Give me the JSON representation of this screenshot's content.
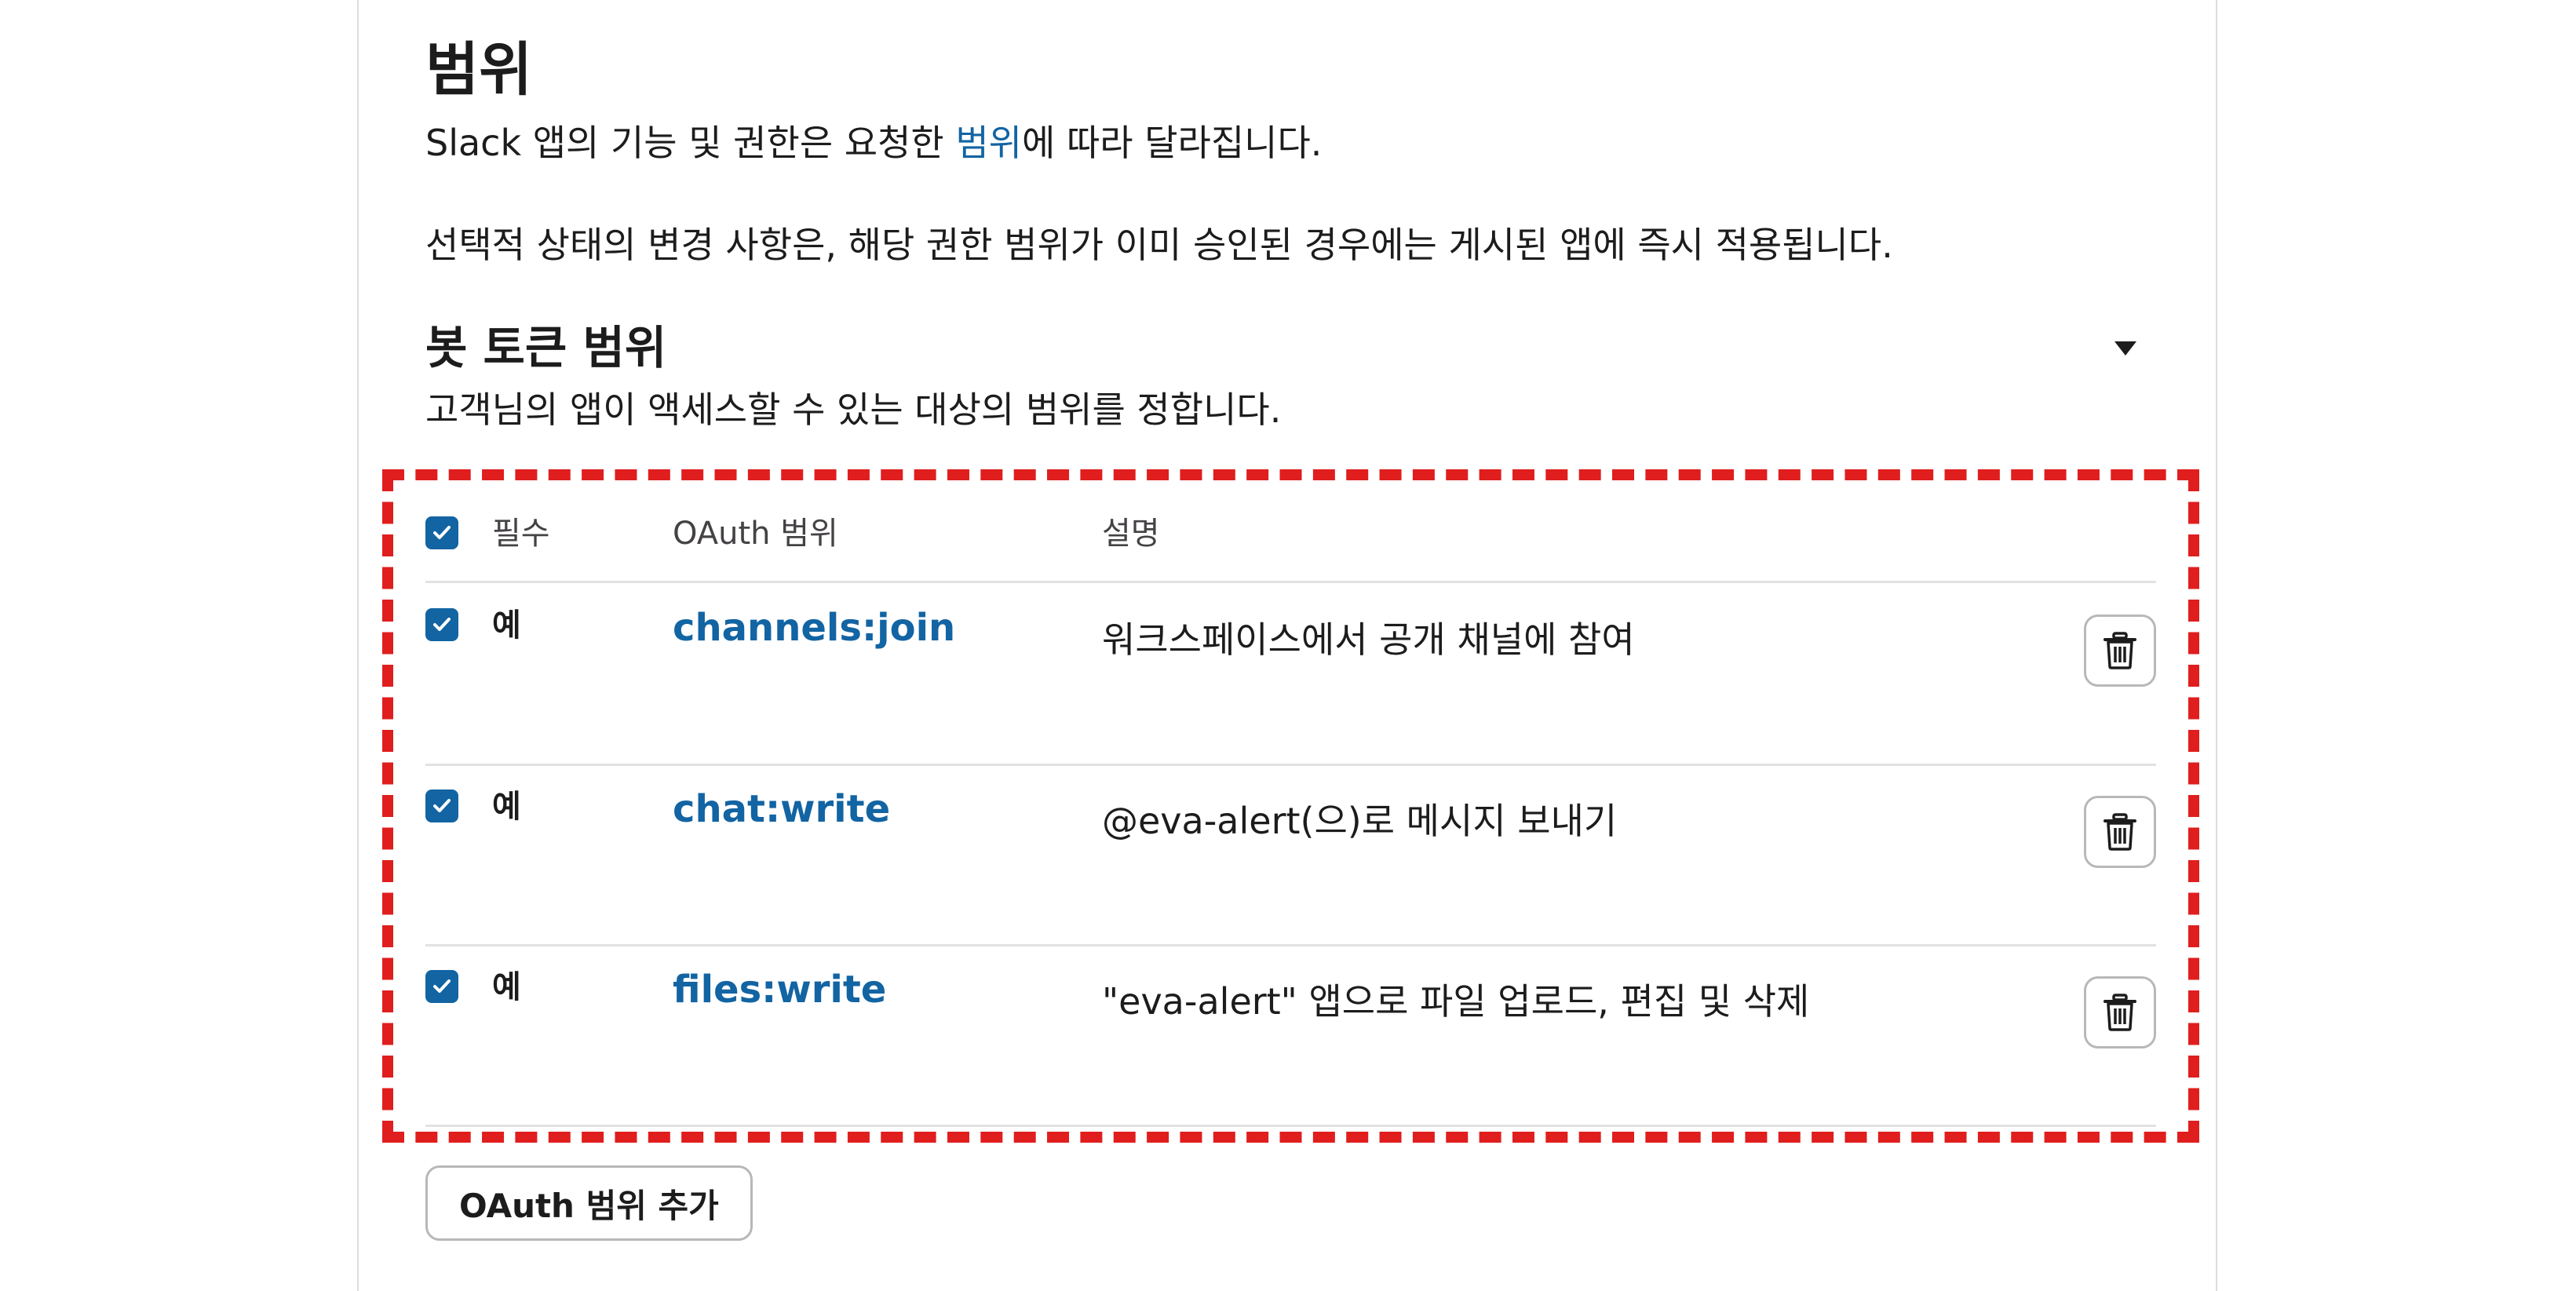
{
  "section": {
    "title": "범위",
    "desc_before": "Slack 앱의 기능 및 권한은 요청한 ",
    "desc_link": "범위",
    "desc_after": "에 따라 달라집니다.",
    "note": "선택적 상태의 변경 사항은, 해당 권한 범위가 이미 승인된 경우에는 게시된 앱에 즉시 적용됩니다."
  },
  "bot_scopes": {
    "title": "봇 토큰 범위",
    "desc": "고객님의 앱이 액세스할 수 있는 대상의 범위를 정합니다.",
    "collapse_icon": "caret-down-icon"
  },
  "table": {
    "headers": {
      "required": "필수",
      "scope": "OAuth 범위",
      "description": "설명"
    },
    "header_checked": true,
    "rows": [
      {
        "checked": true,
        "required": "예",
        "scope": "channels:join",
        "description": "워크스페이스에서 공개 채널에 참여"
      },
      {
        "checked": true,
        "required": "예",
        "scope": "chat:write",
        "description": "@eva-alert(으)로 메시지 보내기"
      },
      {
        "checked": true,
        "required": "예",
        "scope": "files:write",
        "description": "\"eva-alert\" 앱으로 파일 업로드, 편집 및 삭제"
      }
    ]
  },
  "add_button": {
    "label": "OAuth 범위 추가"
  },
  "colors": {
    "link": "#1264a3",
    "checkbox": "#1264a3",
    "highlight": "#e01e1e"
  }
}
